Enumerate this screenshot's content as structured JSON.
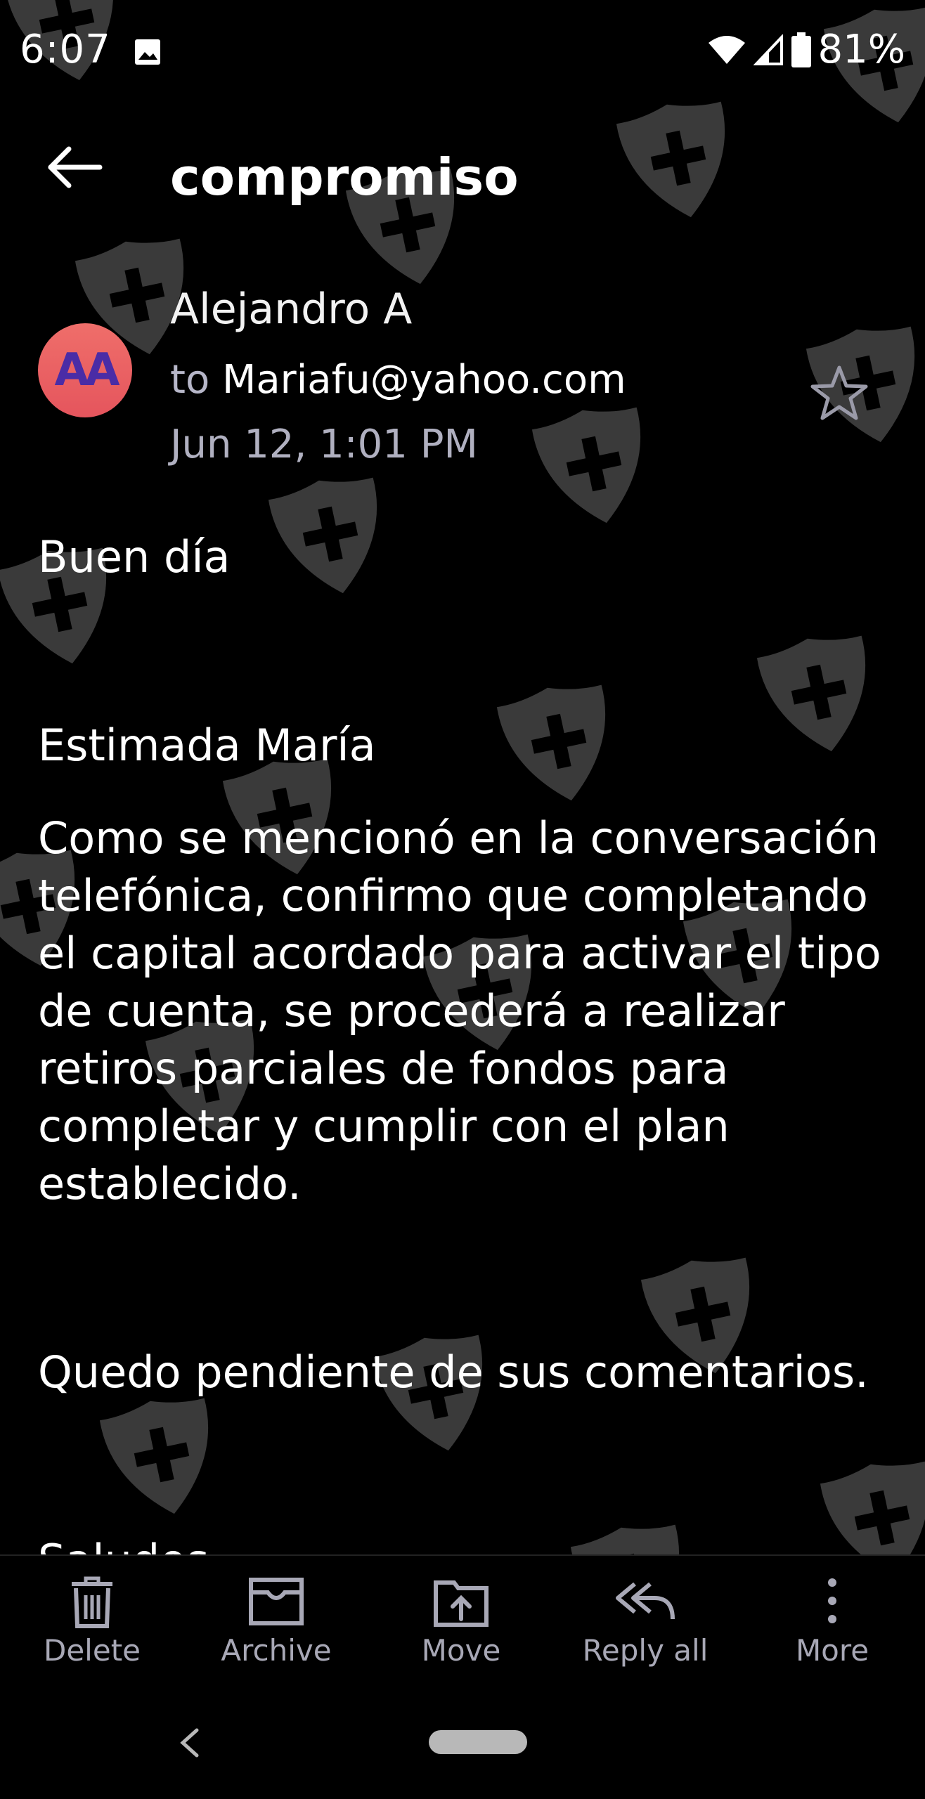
{
  "status_bar": {
    "time": "6:07",
    "battery": "81%"
  },
  "header": {
    "subject": "compromiso"
  },
  "sender": {
    "avatar_initials": "AA",
    "name": "Alejandro A",
    "to_prefix": "to",
    "recipient": "Mariafu@yahoo.com",
    "date": "Jun 12, 1:01 PM"
  },
  "body": {
    "greeting": "Buen día",
    "salutation": "Estimada María",
    "paragraph": "Como se mencionó en la conversación telefónica, confirmo que completando el capital acordado para activar el tipo de cuenta, se procederá a realizar retiros parciales de fondos para completar y cumplir con el plan establecido.",
    "closing": "Quedo pendiente de sus comentarios.",
    "cutoff_line": "Saludos"
  },
  "toolbar": {
    "delete": "Delete",
    "archive": "Archive",
    "move": "Move",
    "reply_all": "Reply all",
    "more": "More"
  },
  "icons": {
    "status": [
      "image-icon",
      "wifi-icon",
      "cell-signal-icon",
      "battery-icon"
    ],
    "header": [
      "back-arrow-icon"
    ],
    "message": [
      "star-icon"
    ],
    "toolbar": [
      "trash-icon",
      "archive-icon",
      "move-icon",
      "reply-all-icon",
      "more-vert-icon"
    ],
    "watermark": "shield-plus-icon"
  },
  "colors": {
    "background": "#000000",
    "text": "#ffffff",
    "muted": "#b0b0c0",
    "avatar": "#e95e60",
    "avatar_text": "#4a2ca6",
    "watermark": "#3a3a3a"
  }
}
